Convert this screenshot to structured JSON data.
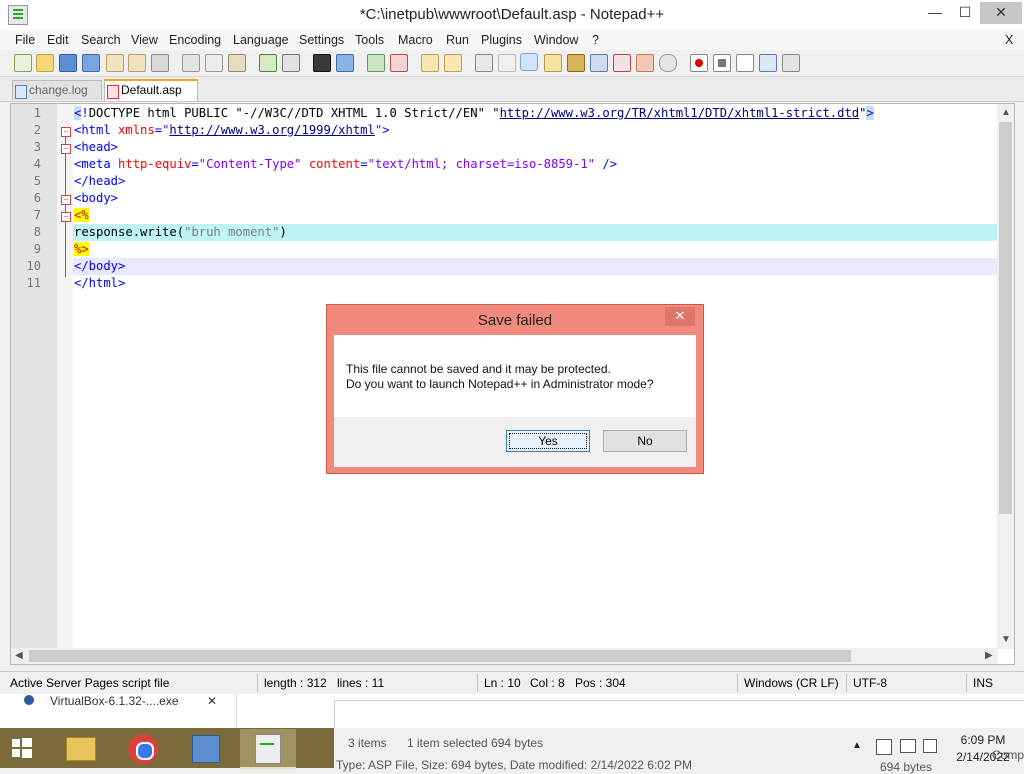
{
  "window": {
    "title": "*C:\\inetpub\\wwwroot\\Default.asp - Notepad++",
    "minimize": "—",
    "maximize": "☐",
    "close": "✕",
    "menu_close": "X"
  },
  "menu": [
    "File",
    "Edit",
    "Search",
    "View",
    "Encoding",
    "Language",
    "Settings",
    "Tools",
    "Macro",
    "Run",
    "Plugins",
    "Window",
    "?"
  ],
  "tabs": [
    {
      "label": "change.log",
      "active": false
    },
    {
      "label": "Default.asp",
      "active": true
    }
  ],
  "editor": {
    "line_numbers": [
      "1",
      "2",
      "3",
      "4",
      "5",
      "6",
      "7",
      "8",
      "9",
      "10",
      "11"
    ]
  },
  "status": {
    "filetype": "Active Server Pages script file",
    "length": "length : 312",
    "lines": "lines : 11",
    "ln": "Ln : 10",
    "col": "Col : 8",
    "pos": "Pos : 304",
    "eol": "Windows (CR LF)",
    "encoding": "UTF-8",
    "mode": "INS"
  },
  "dialog": {
    "title": "Save failed",
    "close": "✕",
    "message_line1": "This file cannot be saved and it may be protected.",
    "message_line2": "Do you want to launch Notepad++ in Administrator mode?",
    "yes": "Yes",
    "no": "No"
  },
  "behind": {
    "download_item": "VirtualBox-6.1.32-....exe",
    "download_close": "✕",
    "items": "3 items",
    "selected": "1 item selected  694 bytes",
    "details": "Type: ASP File, Size: 694 bytes, Date modified: 2/14/2022 6:02 PM",
    "size_trunc": "694 bytes",
    "comp_trunc": "Comp"
  },
  "taskbar": {
    "time": "6:09 PM",
    "date": "2/14/2022"
  }
}
